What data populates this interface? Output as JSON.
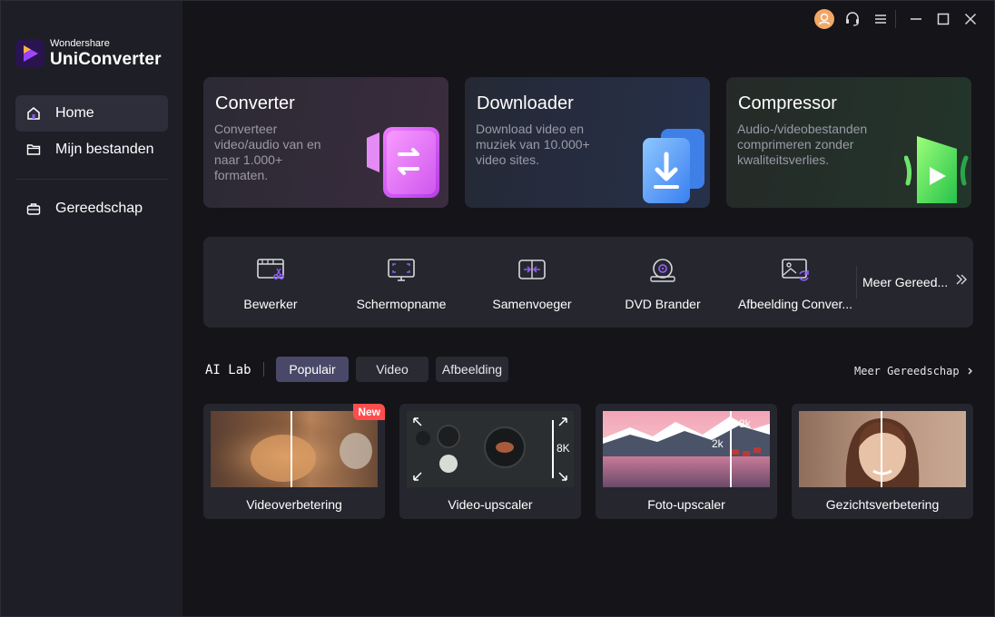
{
  "brand": {
    "company": "Wondershare",
    "product": "UniConverter"
  },
  "sidebar": {
    "items": [
      {
        "label": "Home",
        "icon": "home-icon",
        "active": true
      },
      {
        "label": "Mijn bestanden",
        "icon": "folder-icon",
        "active": false
      },
      {
        "label": "Gereedschap",
        "icon": "toolbox-icon",
        "active": false
      }
    ]
  },
  "titlebar": {
    "icons": [
      "user-avatar-icon",
      "headset-icon",
      "menu-icon",
      "minimize-icon",
      "maximize-icon",
      "close-icon"
    ],
    "avatar_color": "#f2a766"
  },
  "hero_cards": [
    {
      "title": "Converter",
      "description": "Converteer video/audio van en naar 1.000+ formaten.",
      "color": "#3a2c3e"
    },
    {
      "title": "Downloader",
      "description": "Download video en muziek van 10.000+ video sites.",
      "color": "#26304a"
    },
    {
      "title": "Compressor",
      "description": "Audio-/videobestanden comprimeren zonder kwaliteitsverlies.",
      "color": "#23332a"
    }
  ],
  "tools": [
    {
      "label": "Bewerker",
      "icon": "editor-icon"
    },
    {
      "label": "Schermopname",
      "icon": "screen-record-icon"
    },
    {
      "label": "Samenvoeger",
      "icon": "merger-icon"
    },
    {
      "label": "DVD Brander",
      "icon": "dvd-icon"
    },
    {
      "label": "Afbeelding Conver...",
      "icon": "image-convert-icon"
    }
  ],
  "more_tools": {
    "label": "Meer Gereed..."
  },
  "ai_lab": {
    "label": "AI Lab",
    "tabs": [
      {
        "label": "Populair",
        "active": true
      },
      {
        "label": "Video",
        "active": false
      },
      {
        "label": "Afbeelding",
        "active": false
      }
    ],
    "more_link": "Meer Gereedschap",
    "cards": [
      {
        "label": "Videoverbetering",
        "badge": "New"
      },
      {
        "label": "Video-upscaler",
        "resolution": "8K"
      },
      {
        "label": "Foto-upscaler",
        "res_high": "8k",
        "res_low": "2k"
      },
      {
        "label": "Gezichtsverbetering"
      }
    ]
  },
  "colors": {
    "accent": "#8c5cf5",
    "new_badge": "#ff4d4d",
    "active_chip": "#4a4868"
  }
}
